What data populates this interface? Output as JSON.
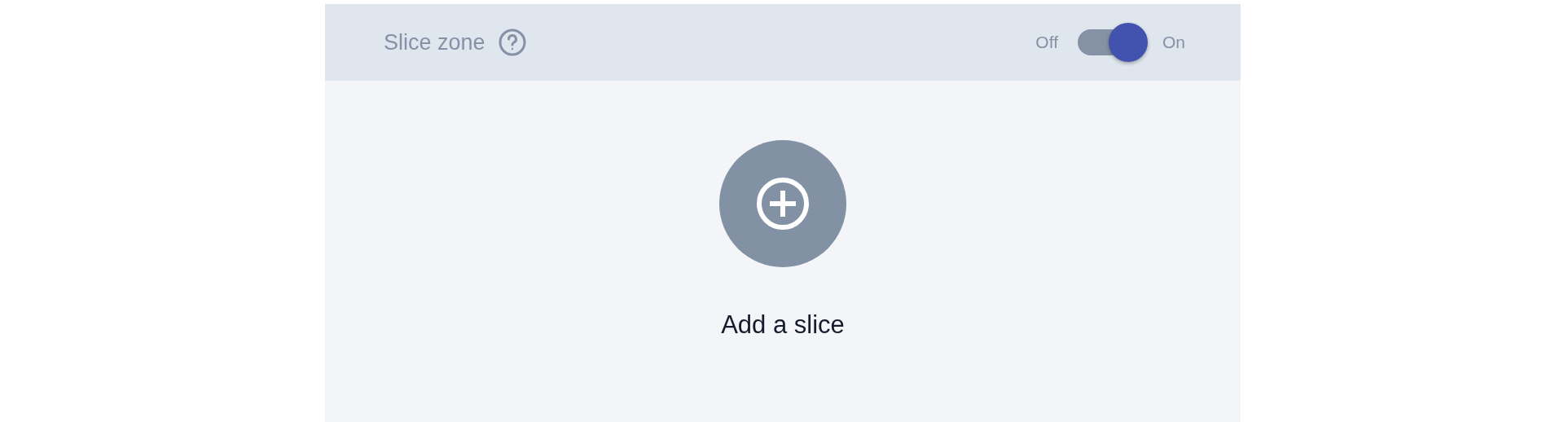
{
  "header": {
    "title": "Slice zone",
    "toggle": {
      "off_label": "Off",
      "on_label": "On",
      "on": true
    }
  },
  "add_slice": {
    "label": "Add a slice"
  }
}
